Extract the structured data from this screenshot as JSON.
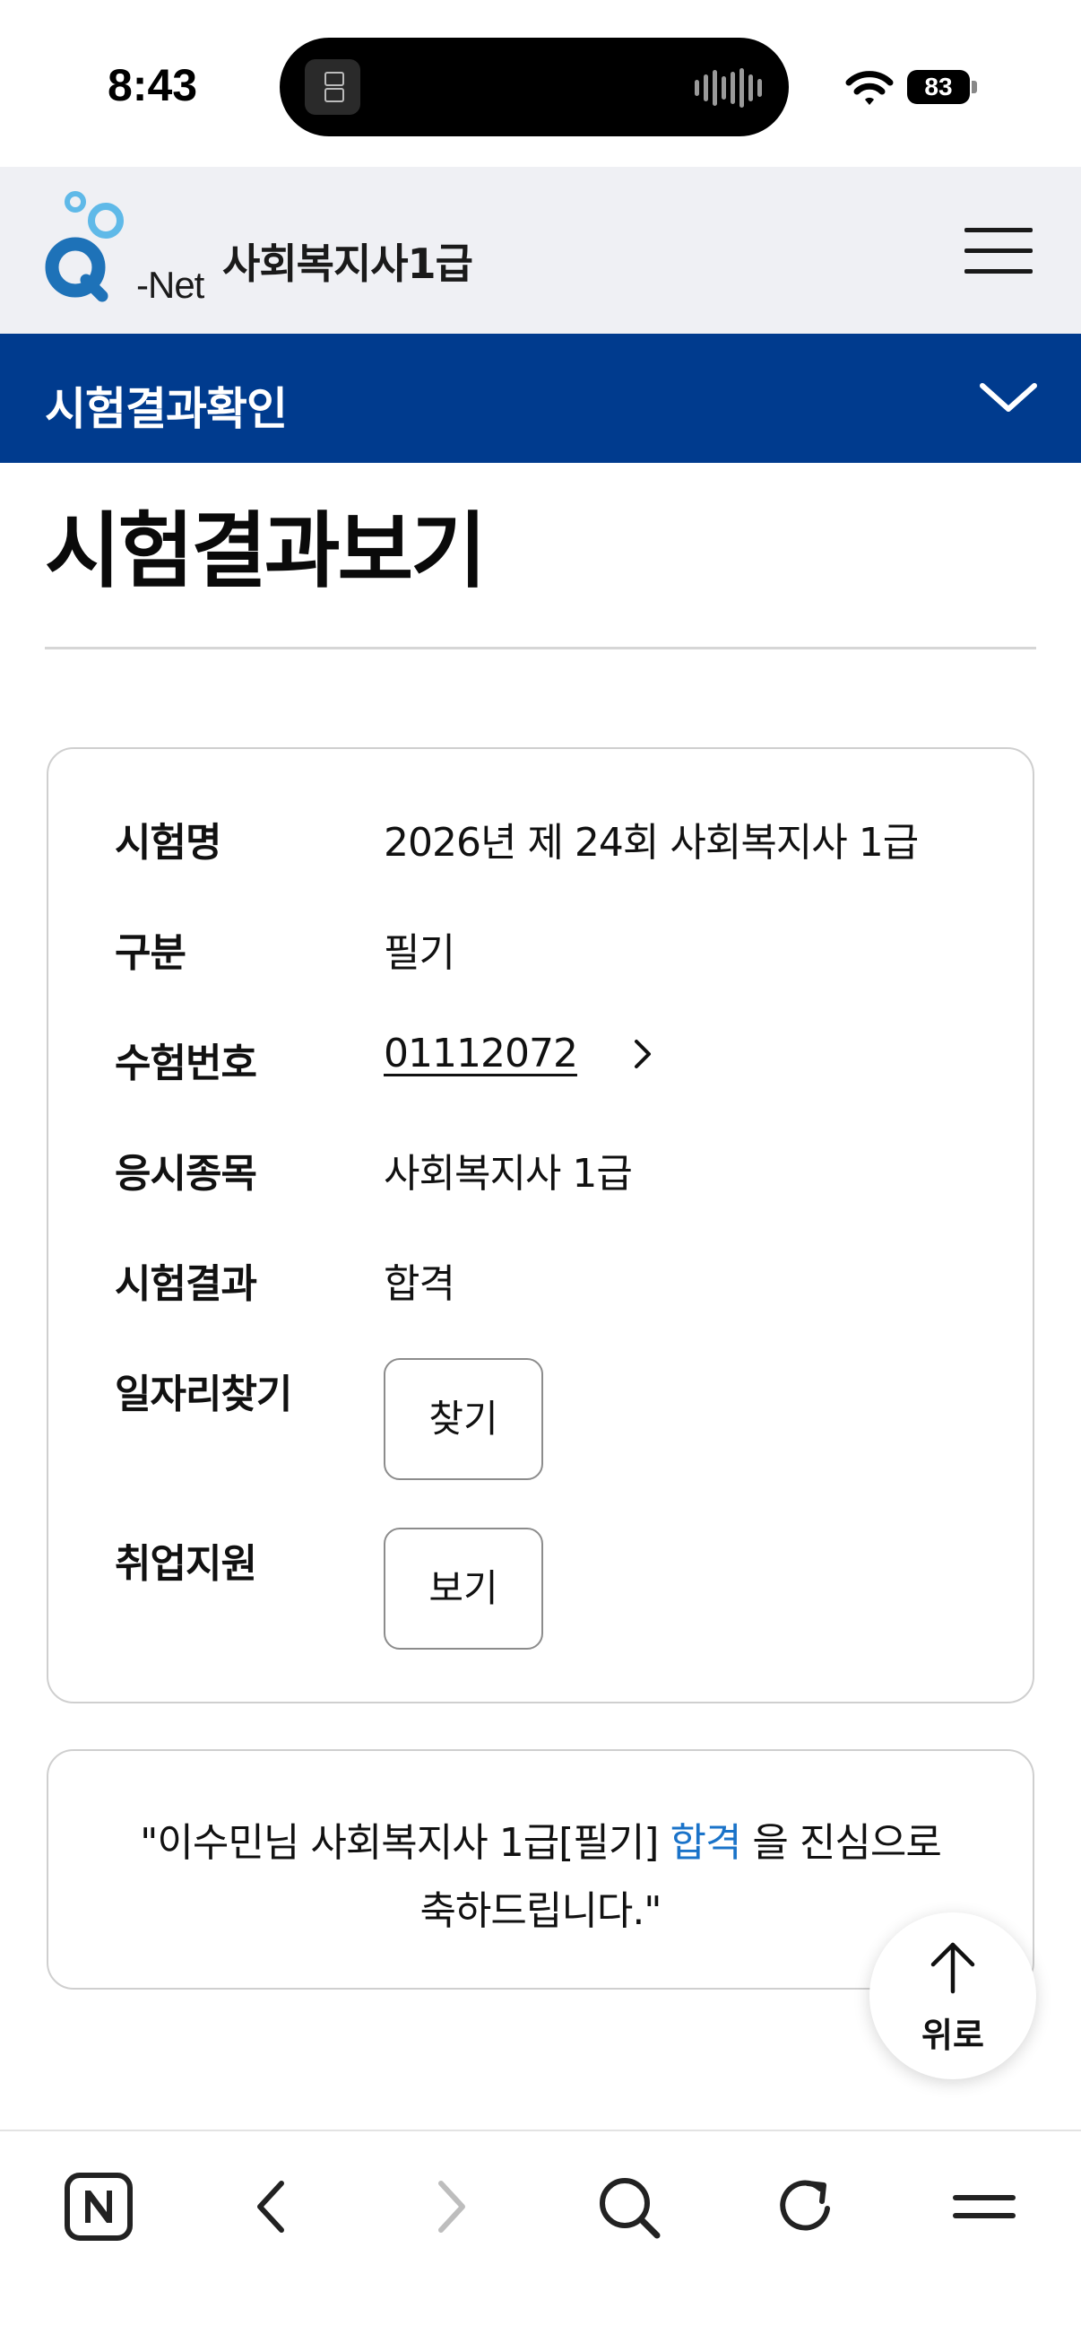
{
  "status_bar": {
    "time": "8:43",
    "battery": "83"
  },
  "header": {
    "logo_text": "-Net",
    "site_title": "사회복지사1급"
  },
  "sub_nav": {
    "label": "시험결과확인"
  },
  "page": {
    "title": "시험결과보기"
  },
  "result": {
    "rows": [
      {
        "label": "시험명",
        "value": "2026년 제 24회 사회복지사 1급"
      },
      {
        "label": "구분",
        "value": "필기"
      },
      {
        "label": "수험번호",
        "value": "01112072"
      },
      {
        "label": "응시종목",
        "value": "사회복지사 1급"
      },
      {
        "label": "시험결과",
        "value": "합격"
      },
      {
        "label": "일자리찾기",
        "button": "찾기"
      },
      {
        "label": "취업지원",
        "button": "보기"
      }
    ]
  },
  "message": {
    "before": "\"이수민님 사회복지사 1급[필기] ",
    "highlight": "합격",
    "after": " 을 진심으로",
    "line2": "축하드립니다.\""
  },
  "scroll_top": {
    "label": "위로"
  },
  "browser_bar": {
    "icons": [
      "n-home-icon",
      "back-icon",
      "forward-icon",
      "search-icon",
      "reload-icon",
      "menu-icon"
    ]
  },
  "colors": {
    "nav_blue": "#003b8e",
    "header_bg": "#eff0f4",
    "highlight_blue": "#1a73c9",
    "logo_blue": "#1e72b8",
    "logo_light_blue": "#5fb9e8"
  }
}
